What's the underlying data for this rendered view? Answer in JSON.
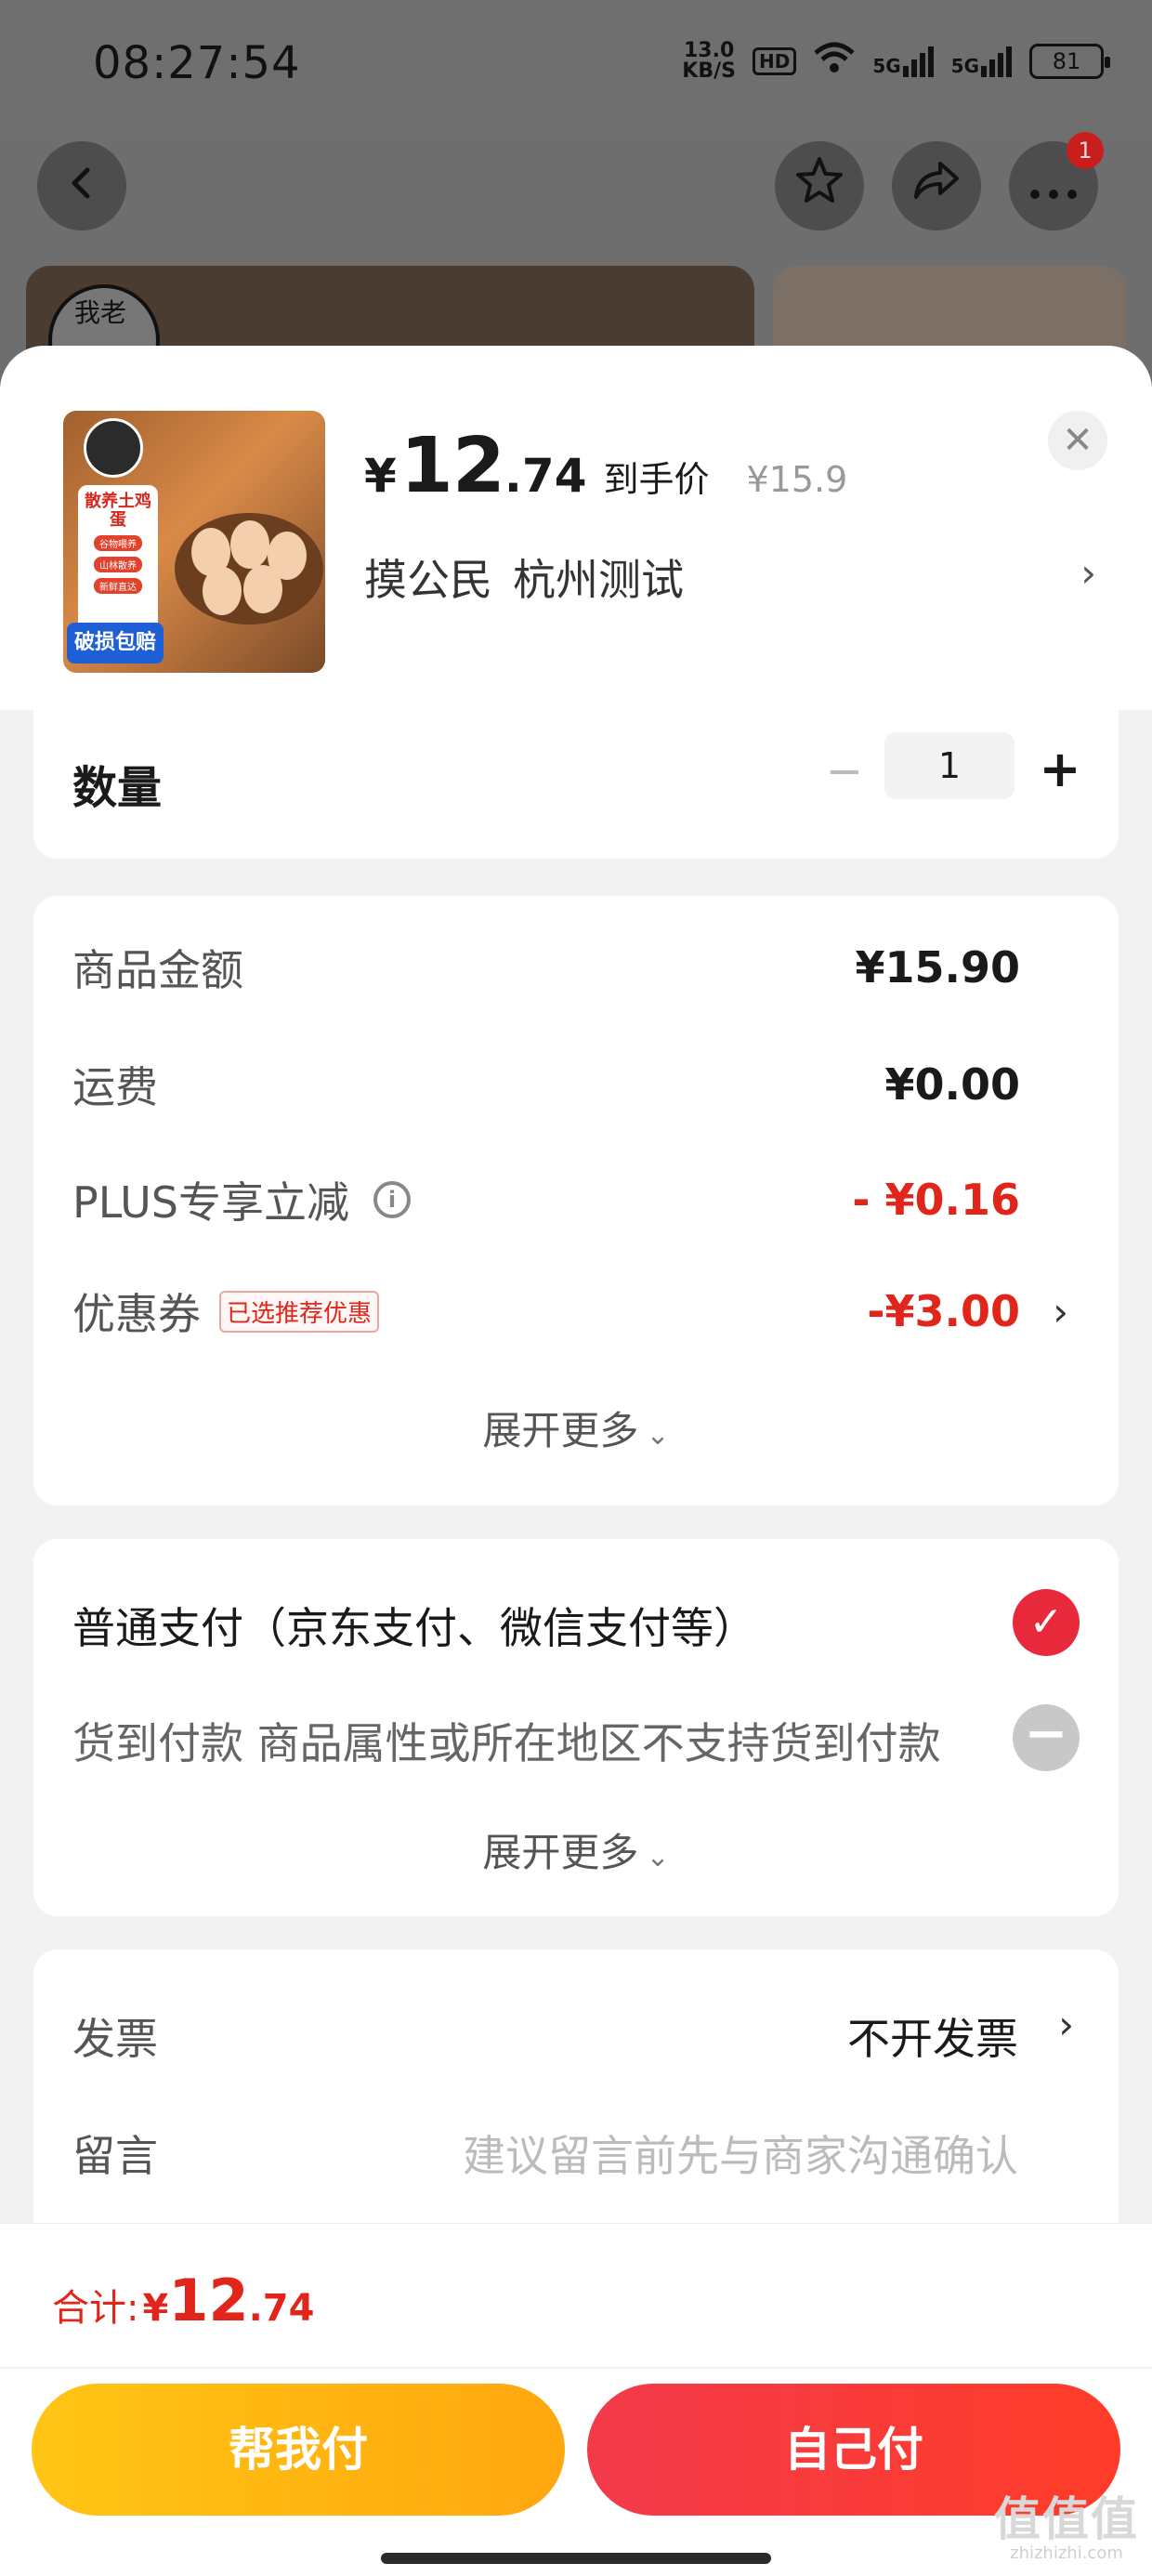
{
  "status_bar": {
    "time": "08:27:54",
    "net_speed_value": "13.0",
    "net_speed_unit": "KB/S",
    "hd_label": "HD",
    "signal1": "5G",
    "signal2": "5G",
    "battery": "81"
  },
  "background": {
    "logo_text": "我老"
  },
  "thumbnail": {
    "tag_title": "散养土鸡蛋",
    "pills": [
      "谷物喂养",
      "山林散养",
      "新鲜直达"
    ],
    "badge": "破损包赔"
  },
  "product": {
    "currency": "¥",
    "price_int": "12",
    "price_dec": ".74",
    "price_tag": "到手价",
    "original_price": "¥15.9",
    "store": "摸公民",
    "location": "杭州测试"
  },
  "quantity": {
    "label": "数量",
    "value": "1",
    "minus": "−",
    "plus": "+"
  },
  "fees": {
    "items": [
      {
        "label": "商品金额",
        "value": "¥15.90"
      },
      {
        "label": "运费",
        "value": "¥0.00"
      },
      {
        "label": "PLUS专享立减",
        "value": "- ¥0.16"
      },
      {
        "label": "优惠券",
        "tag": "已选推荐优惠",
        "value": "-¥3.00"
      }
    ],
    "expand": "展开更多"
  },
  "payment": {
    "normal": "普通支付（京东支付、微信支付等）",
    "cod": "货到付款 商品属性或所在地区不支持货到付款",
    "expand": "展开更多"
  },
  "invoice": {
    "label": "发票",
    "value": "不开发票"
  },
  "message": {
    "label": "留言",
    "placeholder": "建议留言前先与商家沟通确认"
  },
  "footer": {
    "total_label": "合计:",
    "currency": "¥",
    "total_int": "12",
    "total_dec": ".74",
    "helper_button": "帮我付",
    "self_button": "自己付"
  },
  "watermark": {
    "mark": "值值值",
    "url": "zhizhizhi.com"
  },
  "colors": {
    "accent_red": "#e1251b",
    "button_yellow": "#ffb712",
    "button_red": "#f23a4b"
  },
  "icons": [
    "back-arrow-icon",
    "star-icon",
    "share-icon",
    "more-icon",
    "close-icon",
    "info-icon",
    "check-icon",
    "minus-circle-icon",
    "chevron-right-icon",
    "chevron-down-icon"
  ]
}
